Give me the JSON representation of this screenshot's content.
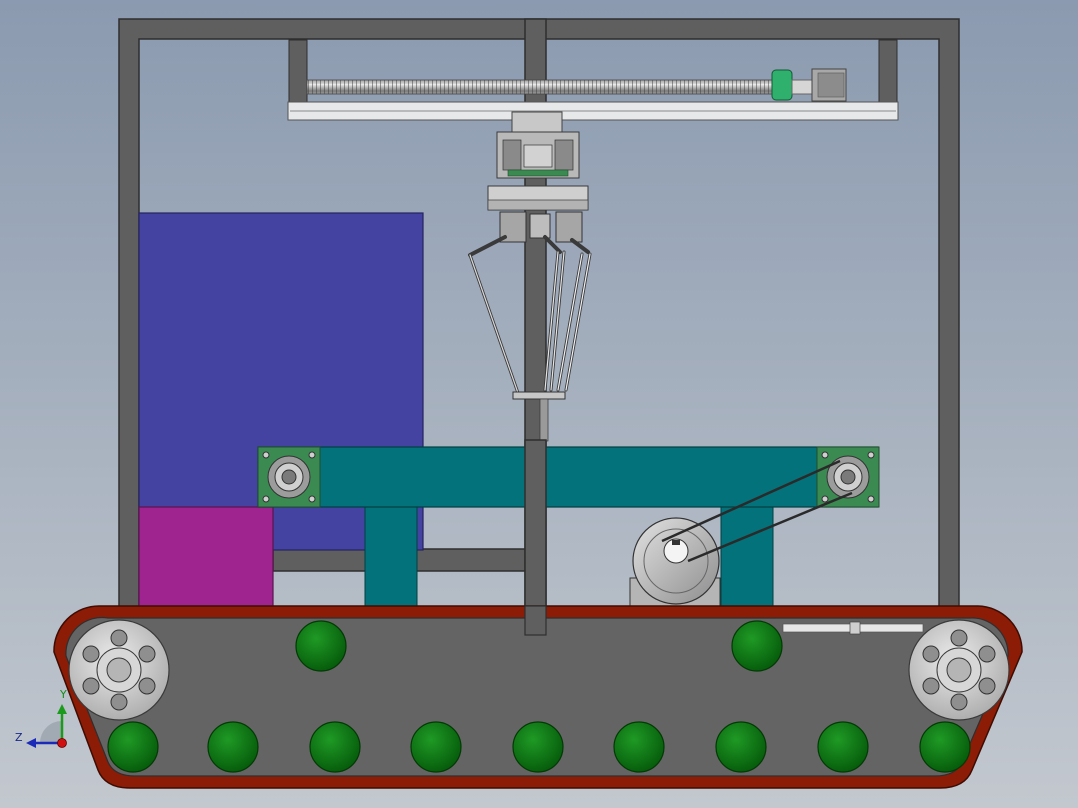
{
  "viewport": {
    "background_top": "#8b9ab0",
    "background_bottom": "#c3c8cf"
  },
  "colors": {
    "frame": "#5f5f5f",
    "frame_edge": "#2e2e2e",
    "panel_blue": "#4443a1",
    "panel_magenta": "#a0248f",
    "conveyor_teal": "#03727a",
    "bearing_green": "#3a8a52",
    "track_red": "#8c1c06",
    "track_body": "#646464",
    "road_wheel": "#0b720f",
    "idler_gray": "#c9c9c9",
    "rail_light": "#e6e8ea",
    "motor_gray": "#a8a8a8",
    "coupler_green": "#2fb06d"
  },
  "icons": {
    "coordinate_triad": "xyz-axis-icon"
  },
  "triad": {
    "z_label": "Z",
    "y_label": "Y"
  },
  "components": {
    "road_wheel_count": 9,
    "upper_wheel_count": 2,
    "idler_count": 2,
    "bearing_block_count": 2,
    "delta_arm_count": 3
  }
}
